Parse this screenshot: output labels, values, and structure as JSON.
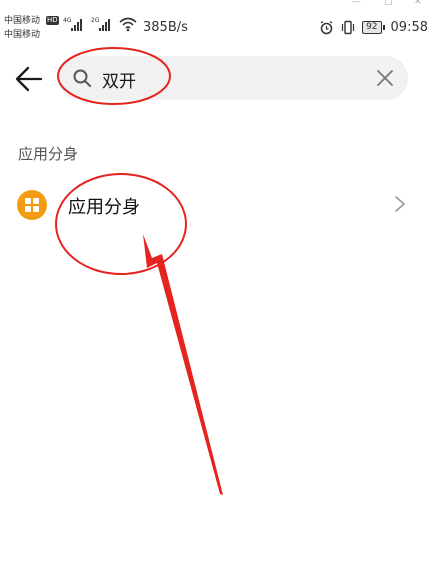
{
  "status_bar": {
    "carrier1": "中国移动",
    "carrier1_badge": "HD",
    "carrier2": "中国移动",
    "signal1_label": "4G",
    "signal2_label": "2G",
    "net_speed": "385B/s",
    "battery": "92",
    "time": "09:58"
  },
  "search": {
    "query": "双开"
  },
  "results": {
    "section_title": "应用分身",
    "items": [
      {
        "label": "应用分身",
        "icon": "app-twin-icon"
      }
    ]
  },
  "colors": {
    "accent_orange": "#f39c12",
    "annotation_red": "#e52420",
    "search_bg": "#f1f1f1"
  }
}
